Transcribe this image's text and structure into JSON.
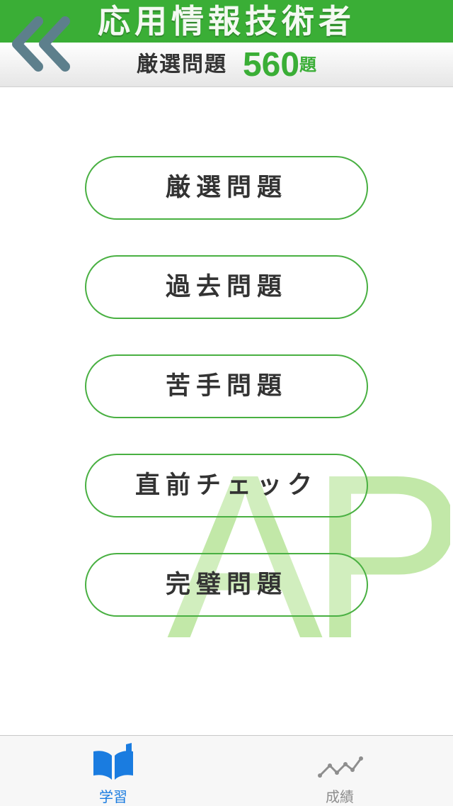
{
  "header": {
    "app_title": "応用情報技術者",
    "subtitle": "厳選問題",
    "count": "560",
    "count_unit": "題"
  },
  "menu": [
    {
      "label": "厳選問題"
    },
    {
      "label": "過去問題"
    },
    {
      "label": "苦手問題"
    },
    {
      "label": "直前チェック"
    },
    {
      "label": "完璧問題"
    }
  ],
  "watermark": "AP",
  "tabbar": {
    "tabs": [
      {
        "label": "学習",
        "icon": "book-icon",
        "selected": true
      },
      {
        "label": "成績",
        "icon": "chart-line-icon",
        "selected": false
      }
    ]
  },
  "colors": {
    "brand_green": "#3aae36",
    "watermark_green": "#c2e8a8",
    "tab_active": "#1a7ce0",
    "tab_inactive": "#8e8e8e",
    "back_icon": "#5d7f8c"
  }
}
